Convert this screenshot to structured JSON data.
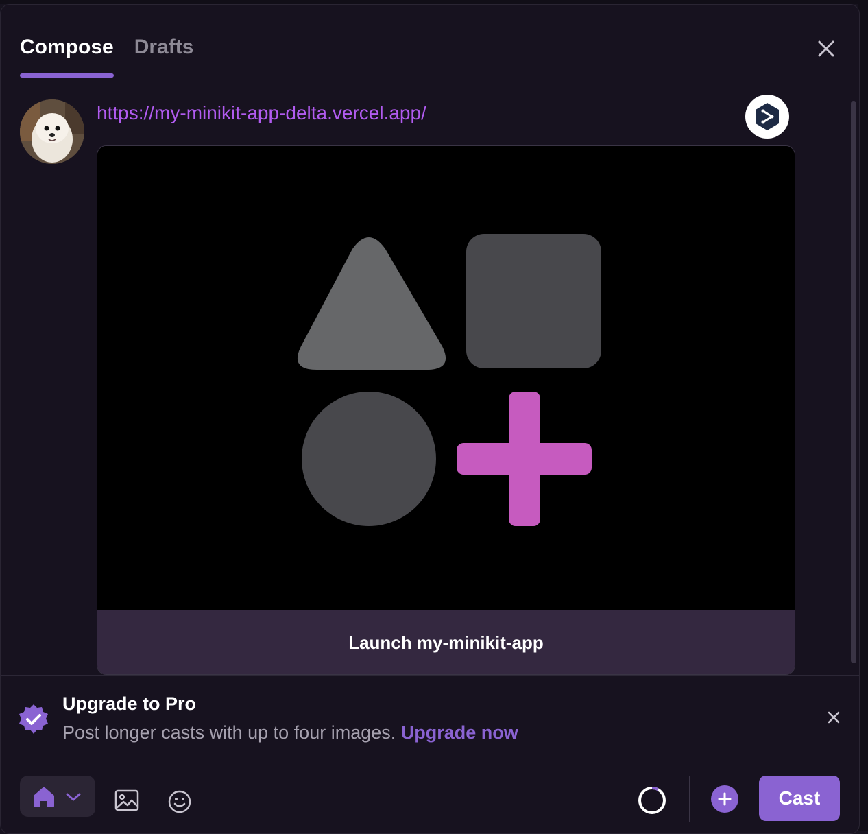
{
  "tabs": [
    {
      "label": "Compose",
      "active": true
    },
    {
      "label": "Drafts",
      "active": false
    }
  ],
  "close_icon": "close-icon",
  "avatar": {
    "icon": "user-avatar-dog"
  },
  "embed": {
    "url": "https://my-minikit-app-delta.vercel.app/",
    "app_icon": "minikit-app-icon",
    "image_icon": "shapes-plus-icon",
    "launch_label": "Launch my-minikit-app"
  },
  "upgrade": {
    "title": "Upgrade to Pro",
    "description": "Post longer casts with up to four images.",
    "link": "Upgrade now",
    "icon": "verified-badge-icon"
  },
  "toolbar": {
    "channel_icon": "home-icon",
    "image_icon": "image-icon",
    "emoji_icon": "emoji-icon",
    "character_progress": 0.08,
    "add_icon": "plus-icon",
    "cast_label": "Cast"
  },
  "colors": {
    "accent": "#8a63d2",
    "link": "#b15bf0",
    "plus_shape": "#c65bbf",
    "background": "#17121f"
  }
}
